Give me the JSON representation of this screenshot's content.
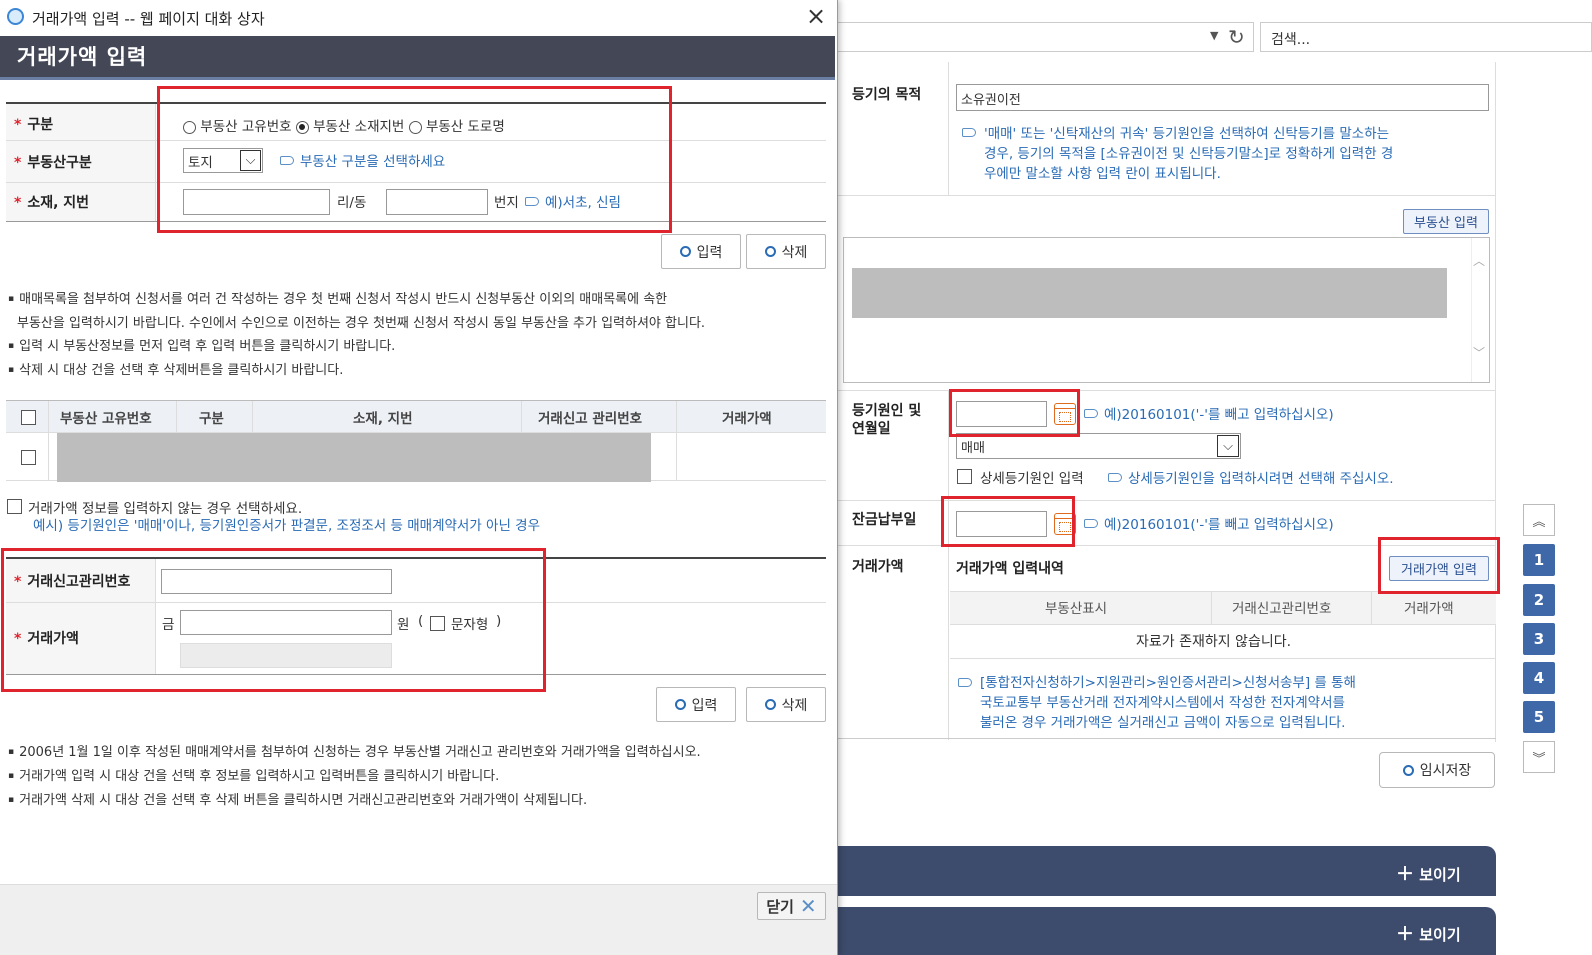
{
  "dialog": {
    "title": "거래가액 입력 -- 웹 페이지 대화 상자",
    "heading": "거래가액 입력",
    "close_label": "닫기"
  },
  "form1": {
    "gubun_label": "구분",
    "radio_options": [
      "부동산 고유번호",
      "부동산 소재지번",
      "부동산 도로명"
    ],
    "selected_radio": "부동산 소재지번",
    "property_type_label": "부동산구분",
    "property_type_value": "토지",
    "property_type_hint": "부동산 구분을 선택하세요",
    "address_label": "소재, 지번",
    "ri_dong": "리/동",
    "beonji": "번지",
    "address_hint": "예)서초, 신림",
    "input_button": "입력",
    "delete_button": "삭제"
  },
  "notes1": [
    "매매목록을 첨부하여 신청서를 여러 건 작성하는 경우 첫 번째 신청서 작성시 반드시 신청부동산 이외의 매매목록에 속한",
    "부동산을 입력하시기 바랍니다. 수인에서 수인으로 이전하는 경우 첫번째 신청서 작성시 동일 부동산을 추가 입력하셔야 합니다.",
    "입력 시 부동산정보를 먼저 입력 후 입력 버튼을 클릭하시기 바랍니다.",
    "삭제 시 대상 건을 선택 후 삭제버튼을 클릭하시기 바랍니다."
  ],
  "table1": {
    "headers": [
      "부동산 고유번호",
      "구분",
      "소재, 지번",
      "거래신고 관리번호",
      "거래가액"
    ]
  },
  "no_price": {
    "label": "거래가액 정보를 입력하지 않는 경우 선택하세요.",
    "example": "예시) 등기원인은 '매매'이나, 등기원인증서가 판결문, 조정조서 등 매매계약서가 아닌 경우"
  },
  "form2": {
    "mgmt_label": "거래신고관리번호",
    "price_label": "거래가액",
    "geum": "금",
    "won": "원",
    "paren_open": "(",
    "paren_close": ")",
    "text_type": "문자형",
    "input_button": "입력",
    "delete_button": "삭제"
  },
  "notes2": [
    "2006년 1월 1일 이후 작성된 매매계약서를 첨부하여 신청하는 경우 부동산별 거래신고 관리번호와 거래가액을 입력하십시오.",
    "거래가액 입력 시 대상 건을 선택 후 정보를 입력하시고 입력버튼을 클릭하시기 바랍니다.",
    "거래가액 삭제 시 대상 건을 선택 후 삭제 버튼을 클릭하시면 거래신고관리번호와 거래가액이 삭제됩니다."
  ],
  "browser": {
    "search_placeholder": "검색..."
  },
  "bg": {
    "purpose_label": "등기의 목적",
    "purpose_value": "소유권이전",
    "purpose_hint_lines": [
      "'매매' 또는 '신탁재산의 귀속' 등기원인을 선택하여 신탁등기를 말소하는",
      "경우, 등기의 목적을 [소유권이전 및 신탁등기말소]로 정확하게 입력한 경",
      "우에만 말소할 사항 입력 란이 표시됩니다."
    ],
    "property_input_button": "부동산 입력",
    "cause_label_lines": [
      "등기원인 및",
      "연월일"
    ],
    "date_hint": "예)20160101('-'를 빼고 입력하십시오)",
    "cause_select": "매매",
    "detail_cause_label": "상세등기원인 입력",
    "detail_cause_hint": "상세등기원인을 입력하시려면 선택해 주십시오.",
    "balance_label": "잔금납부일",
    "balance_hint": "예)20160101('-'를 빼고 입력하십시오)",
    "price_label": "거래가액",
    "price_history_title": "거래가액 입력내역",
    "price_input_button": "거래가액 입력",
    "price_table_headers": [
      "부동산표시",
      "거래신고관리번호",
      "거래가액"
    ],
    "no_data": "자료가 존재하지 않습니다.",
    "price_note_lines": [
      "[통합전자신청하기>지원관리>원인증서관리>신청서송부] 를 통해",
      "국토교통부 부동산거래 전자계약시스템에서 작성한 전자계약서를",
      "불러온 경우 거래가액은 실거래신고 금액이 자동으로 입력됩니다."
    ],
    "temp_save": "임시저장",
    "show_label": "보이기",
    "side_nums": [
      "1",
      "2",
      "3",
      "4",
      "5"
    ]
  },
  "colors": {
    "accent": "#3f68a8",
    "highlight": "#e0242e",
    "hint": "#2a6bb5"
  }
}
